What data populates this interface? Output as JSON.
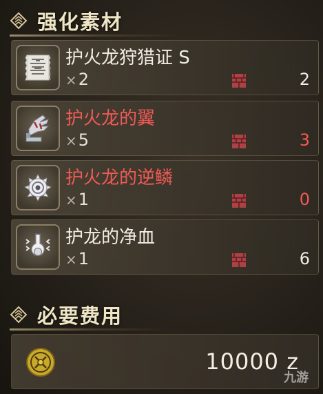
{
  "materials_section": {
    "title": "强化素材"
  },
  "items": [
    {
      "name": "护火龙狩猎证 S",
      "required": "2",
      "owned": "2",
      "insufficient": false,
      "icon": "scroll-icon"
    },
    {
      "name": "护火龙的翼",
      "required": "5",
      "owned": "3",
      "insufficient": true,
      "icon": "wing-icon"
    },
    {
      "name": "护火龙的逆鳞",
      "required": "1",
      "owned": "0",
      "insufficient": true,
      "icon": "scale-icon"
    },
    {
      "name": "护龙的净血",
      "required": "1",
      "owned": "6",
      "insufficient": false,
      "icon": "blood-vial-icon"
    }
  ],
  "quantity_prefix": "×",
  "cost_section": {
    "title": "必要费用"
  },
  "cost": {
    "value": "10000 z",
    "icon": "zenny-coin-icon"
  },
  "watermark": "九游",
  "colors": {
    "insufficient": "#ef5a55",
    "normal": "#f1ede4",
    "box": "#c0464b"
  }
}
